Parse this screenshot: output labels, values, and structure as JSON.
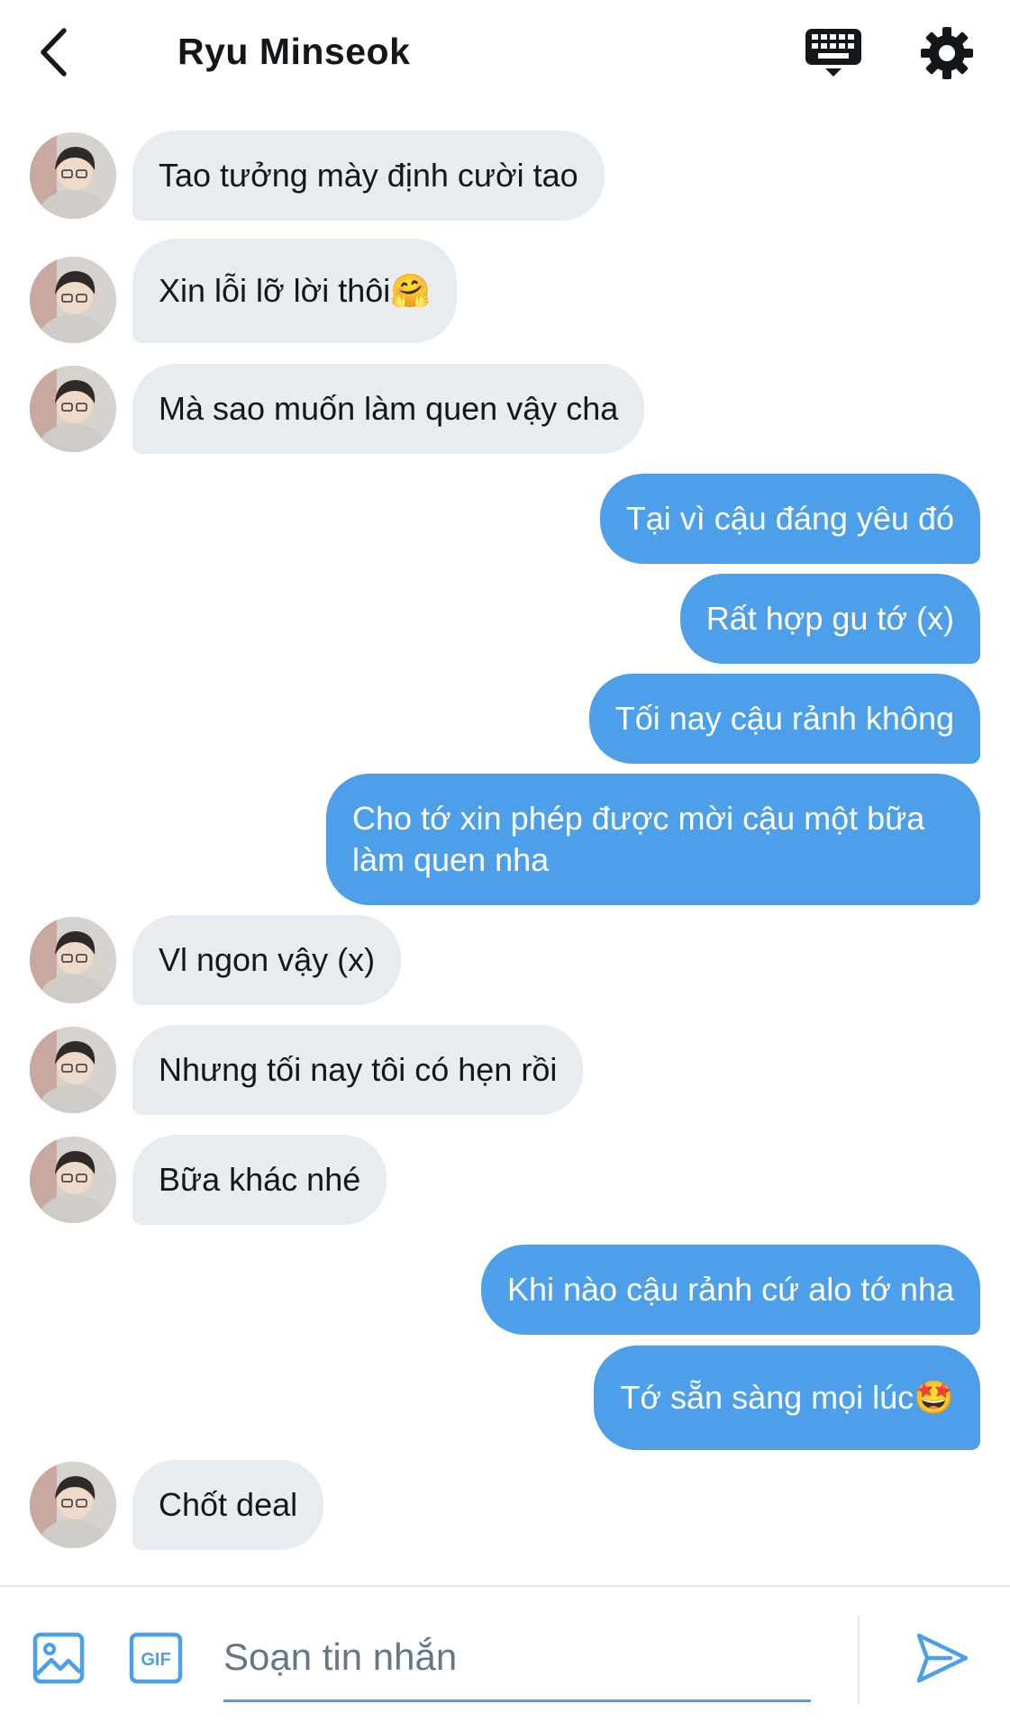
{
  "header": {
    "title": "Ryu Minseok",
    "back_icon": "chevron-left-icon",
    "keyboard_icon": "keyboard-icon",
    "settings_icon": "gear-icon"
  },
  "messages": [
    {
      "from": "them",
      "text": "Tao tưởng mày định cười tao"
    },
    {
      "from": "them",
      "text": "Xin lỗi lỡ lời thôi🤗"
    },
    {
      "from": "them",
      "text": "Mà sao muốn làm quen vậy cha"
    },
    {
      "from": "me",
      "text": "Tại vì cậu đáng yêu đó"
    },
    {
      "from": "me",
      "text": "Rất hợp gu tớ (x)"
    },
    {
      "from": "me",
      "text": "Tối nay cậu rảnh không"
    },
    {
      "from": "me",
      "text": "Cho tớ xin phép được mời cậu một bữa làm quen nha"
    },
    {
      "from": "them",
      "text": "Vl ngon vậy (x)"
    },
    {
      "from": "them",
      "text": "Nhưng tối nay tôi có hẹn rồi"
    },
    {
      "from": "them",
      "text": "Bữa khác nhé"
    },
    {
      "from": "me",
      "text": "Khi nào cậu rảnh cứ alo tớ nha"
    },
    {
      "from": "me",
      "text": "Tớ sẵn sàng mọi lúc🤩"
    },
    {
      "from": "them",
      "text": "Chốt deal"
    }
  ],
  "composer": {
    "placeholder": "Soạn tin nhắn",
    "value": "",
    "media_icon": "image-icon",
    "gif_label": "GIF",
    "send_icon": "send-icon"
  },
  "colors": {
    "accent": "#4c9fe8",
    "incoming_bubble": "#e6ecf0",
    "outgoing_text": "#ffffff",
    "text": "#14171a",
    "placeholder": "#657786"
  }
}
